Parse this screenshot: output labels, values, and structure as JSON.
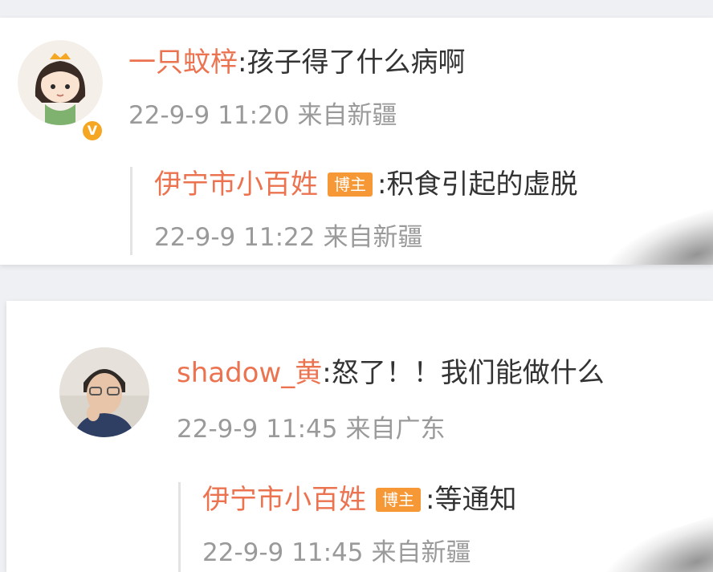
{
  "comments": [
    {
      "user": "一只蚊梓",
      "separator": ":",
      "text": "孩子得了什么病啊",
      "time": "22-9-9 11:20",
      "location": "来自新疆",
      "verified_badge": "V",
      "reply": {
        "user": "伊宁市小百姓",
        "tag": "博主",
        "separator": ":",
        "text": "积食引起的虚脱",
        "time": "22-9-9 11:22",
        "location": "来自新疆"
      }
    },
    {
      "user": "shadow_黄",
      "separator": ":",
      "text": "怒了！！我们能做什么",
      "time": "22-9-9 11:45",
      "location": "来自广东",
      "reply": {
        "user": "伊宁市小百姓",
        "tag": "博主",
        "separator": ":",
        "text": "等通知",
        "time": "22-9-9 11:45",
        "location": "来自新疆"
      }
    }
  ],
  "colors": {
    "username": "#eb7350",
    "body_text": "#333333",
    "meta_text": "#9a9a9a",
    "tag_bg": "#f79837",
    "verified": "#f5a623"
  }
}
